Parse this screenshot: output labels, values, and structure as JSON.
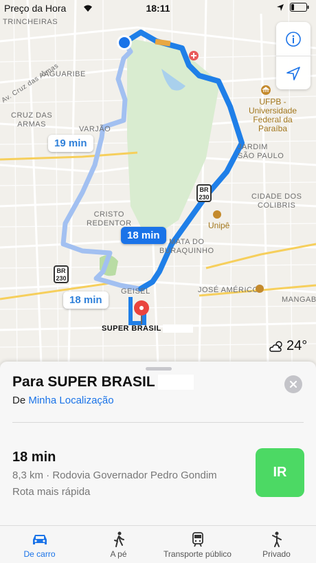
{
  "status_bar": {
    "carrier": "Preço da Hora",
    "time": "18:11"
  },
  "map": {
    "labels": {
      "trincheiras": "TRINCHEIRAS",
      "jaguaribe": "JAGUARIBE",
      "av_cruz": "Av. Cruz das Armas",
      "cruz_das_armas_1": "CRUZ DAS",
      "cruz_das_armas_2": "ARMAS",
      "varjao": "VARJÃO",
      "ufpb_1": "UFPB -",
      "ufpb_2": "Universidade",
      "ufpb_3": "Federal da",
      "ufpb_4": "Paraíba",
      "jardim_1": "JARDIM",
      "jardim_2": "SÃO PAULO",
      "cidade_1": "CIDADE DOS",
      "cidade_2": "COLIBRIS",
      "cristo_1": "CRISTO",
      "cristo_2": "REDENTOR",
      "unipe": "Unipê",
      "bairro_1": "MATA DO",
      "bairro_2": "BURAQUINHO",
      "jose_americo": "JOSÉ AMÉRICO",
      "geisel": "GEISEL",
      "mangabeira": "MANGABE"
    },
    "shield_top": "BR",
    "shield_number": "230",
    "routes": {
      "alt_1": "19 min",
      "primary": "18 min",
      "alt_2": "18 min"
    },
    "destination_label": "SUPER BRASIL",
    "weather_temp": "24°"
  },
  "sheet": {
    "title": "Para SUPER BRASIL",
    "from_prefix": "De",
    "from_link": "Minha Localização",
    "eta": "18 min",
    "detail": "8,3 km · Rodovia Governador Pedro Gondim",
    "note": "Rota mais rápida",
    "go_label": "IR"
  },
  "tabs": [
    {
      "label": "De carro",
      "icon": "car-icon",
      "active": true
    },
    {
      "label": "A pé",
      "icon": "walk-icon",
      "active": false
    },
    {
      "label": "Transporte público",
      "icon": "train-icon",
      "active": false
    },
    {
      "label": "Privado",
      "icon": "ride-icon",
      "active": false
    }
  ],
  "colors": {
    "route_primary": "#1a84f2",
    "route_alt": "#9fbdf0",
    "go_button": "#4cd964",
    "link": "#1a73e8"
  }
}
